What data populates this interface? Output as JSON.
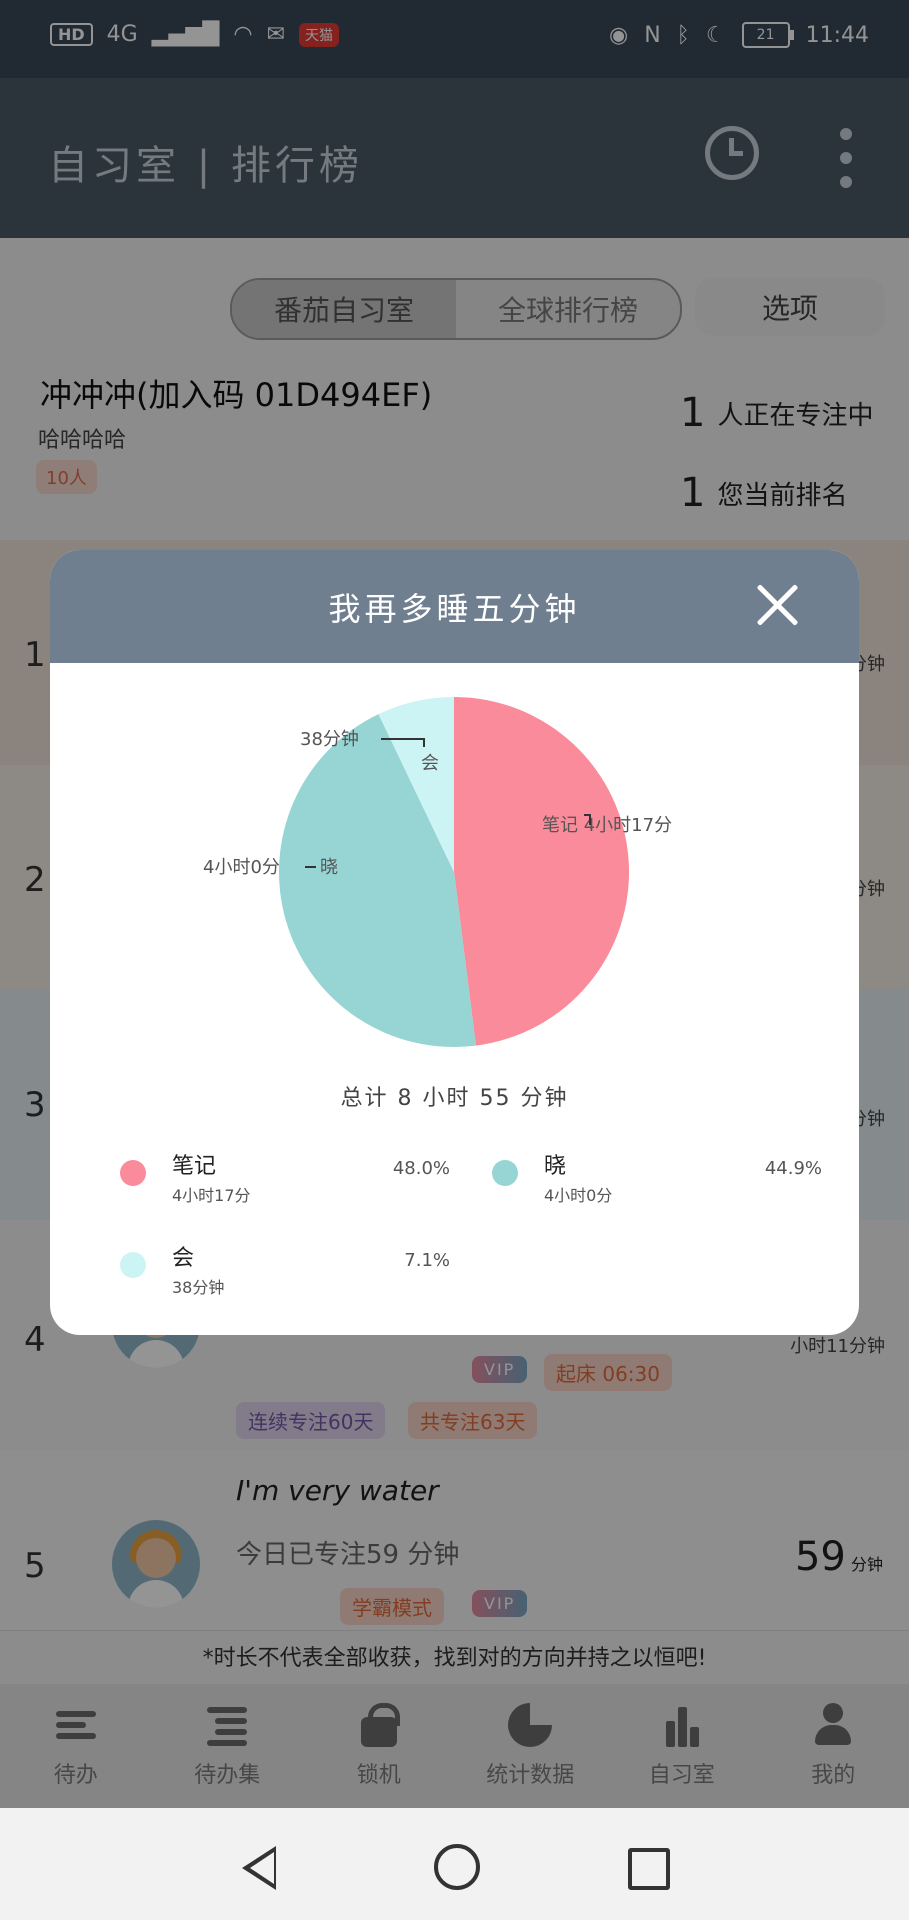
{
  "status_bar": {
    "left": [
      "HD",
      "4G",
      "天猫"
    ],
    "time": "11:44",
    "battery": "21"
  },
  "app_bar": {
    "title": "自习室 | 排行榜"
  },
  "tabs": {
    "items": [
      "番茄自习室",
      "全球排行榜"
    ],
    "active": 0,
    "options_label": "选项"
  },
  "room": {
    "name": "冲冲冲(加入码 01D494EF)",
    "desc": "哈哈哈哈",
    "member_count": "10人",
    "focusing_num": "1",
    "focusing_label": "人正在专注中",
    "rank_num": "1",
    "rank_label": "您当前排名"
  },
  "rankings": [
    {
      "rank": "1",
      "side": "分钟"
    },
    {
      "rank": "2",
      "side": "分钟"
    },
    {
      "rank": "3",
      "side": "分钟"
    },
    {
      "rank": "4",
      "side": "小时11分钟",
      "badges": [
        "VIP",
        "起床 06:30"
      ],
      "tags": [
        "连续专注60天",
        "共专注63天"
      ]
    },
    {
      "rank": "5",
      "name": "I'm very water",
      "today": "今日已专注59 分钟",
      "value": "59",
      "unit": "分钟",
      "badges": [
        "学霸模式",
        "VIP"
      ]
    }
  ],
  "footer_note": "*时长不代表全部收获，找到对的方向并持之以恒吧!",
  "bottom_nav": [
    {
      "label": "待办",
      "icon": "list-icon"
    },
    {
      "label": "待办集",
      "icon": "list-collection-icon"
    },
    {
      "label": "锁机",
      "icon": "lock-icon"
    },
    {
      "label": "统计数据",
      "icon": "pie-chart-icon"
    },
    {
      "label": "自习室",
      "icon": "bar-chart-icon"
    },
    {
      "label": "我的",
      "icon": "user-icon"
    }
  ],
  "dialog": {
    "title": "我再多睡五分钟",
    "total": "总计 8 小时 55 分钟",
    "legend": [
      {
        "name": "笔记",
        "sub": "4小时17分",
        "pct": "48.0%",
        "color": "#f98b9b"
      },
      {
        "name": "晓",
        "sub": "4小时0分",
        "pct": "44.9%",
        "color": "#97d4d4"
      },
      {
        "name": "会",
        "sub": "38分钟",
        "pct": "7.1%",
        "color": "#cdf4f4"
      }
    ]
  },
  "chart_data": {
    "type": "pie",
    "categories": [
      "笔记",
      "晓",
      "会"
    ],
    "values": [
      48.0,
      44.9,
      7.1
    ],
    "slice_labels": [
      "4小时17分",
      "4小时0分",
      "38分钟"
    ],
    "colors": [
      "#f98b9b",
      "#97d4d4",
      "#cdf4f4"
    ]
  }
}
